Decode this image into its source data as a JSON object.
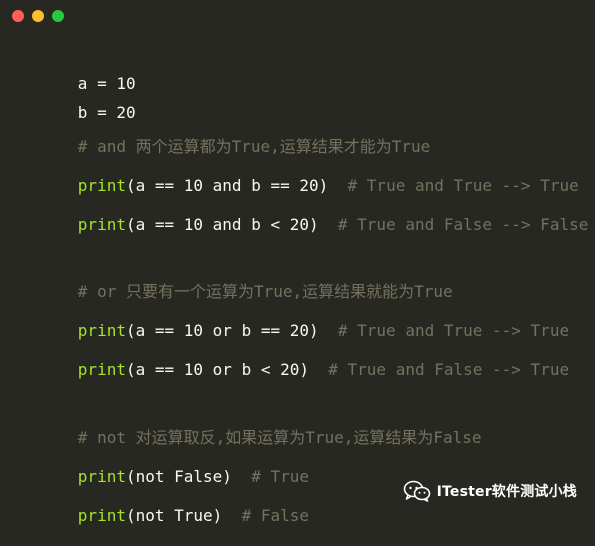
{
  "window": {
    "traffic_lights": {
      "close_color": "#ff5f56",
      "minimize_color": "#ffbd2e",
      "maximize_color": "#27c93f"
    }
  },
  "code": {
    "line_01": {
      "text": "a = 10"
    },
    "line_02": {
      "text": "b = 20"
    },
    "line_03": {
      "text": "# and 两个运算都为True,运算结果才能为True"
    },
    "line_04": {
      "fn": "print",
      "args": "(a == 10 and b == 20)",
      "comment": "  # True and True --> True"
    },
    "line_05": {
      "fn": "print",
      "args": "(a == 10 and b < 20)",
      "comment": "  # True and False --> False"
    },
    "line_06": {
      "text": "# or 只要有一个运算为True,运算结果就能为True"
    },
    "line_07": {
      "fn": "print",
      "args": "(a == 10 or b == 20)",
      "comment": "  # True and True --> True"
    },
    "line_08": {
      "fn": "print",
      "args": "(a == 10 or b < 20)",
      "comment": "  # True and False --> True"
    },
    "line_09": {
      "text": "# not 对运算取反,如果运算为True,运算结果为False"
    },
    "line_10": {
      "fn": "print",
      "args": "(not False)",
      "comment": "  # True"
    },
    "line_11": {
      "fn": "print",
      "args": "(not True)",
      "comment": "  # False"
    }
  },
  "watermark": {
    "text": "ITester软件测试小栈",
    "icon": "wechat-icon"
  },
  "colors": {
    "background": "#272822",
    "default_text": "#f8f8f2",
    "comment": "#75715e",
    "function": "#a6e22e"
  }
}
